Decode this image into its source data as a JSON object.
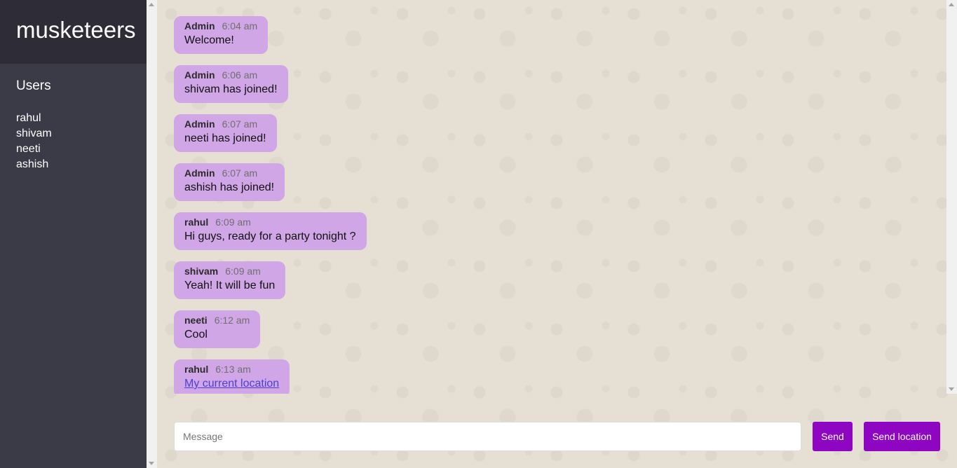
{
  "sidebar": {
    "room_name": "musketeers",
    "users_title": "Users",
    "users": [
      "rahul",
      "shivam",
      "neeti",
      "ashish"
    ]
  },
  "messages": [
    {
      "user": "Admin",
      "time": "6:04 am",
      "text": "Welcome!"
    },
    {
      "user": "Admin",
      "time": "6:06 am",
      "text": "shivam has joined!"
    },
    {
      "user": "Admin",
      "time": "6:07 am",
      "text": "neeti has joined!"
    },
    {
      "user": "Admin",
      "time": "6:07 am",
      "text": "ashish has joined!"
    },
    {
      "user": "rahul",
      "time": "6:09 am",
      "text": "Hi guys, ready for a party tonight ?"
    },
    {
      "user": "shivam",
      "time": "6:09 am",
      "text": "Yeah! It will be fun"
    },
    {
      "user": "neeti",
      "time": "6:12 am",
      "text": "Cool"
    },
    {
      "user": "rahul",
      "time": "6:13 am",
      "link_text": "My current location"
    }
  ],
  "composer": {
    "placeholder": "Message",
    "value": "",
    "send_label": "Send",
    "send_location_label": "Send location"
  },
  "colors": {
    "sidebar_bg": "#3a3b47",
    "room_header_bg": "#2d2c37",
    "bubble_bg": "#d0a6e6",
    "button_bg": "#8e05c2",
    "chat_bg": "#e6dfd3"
  }
}
